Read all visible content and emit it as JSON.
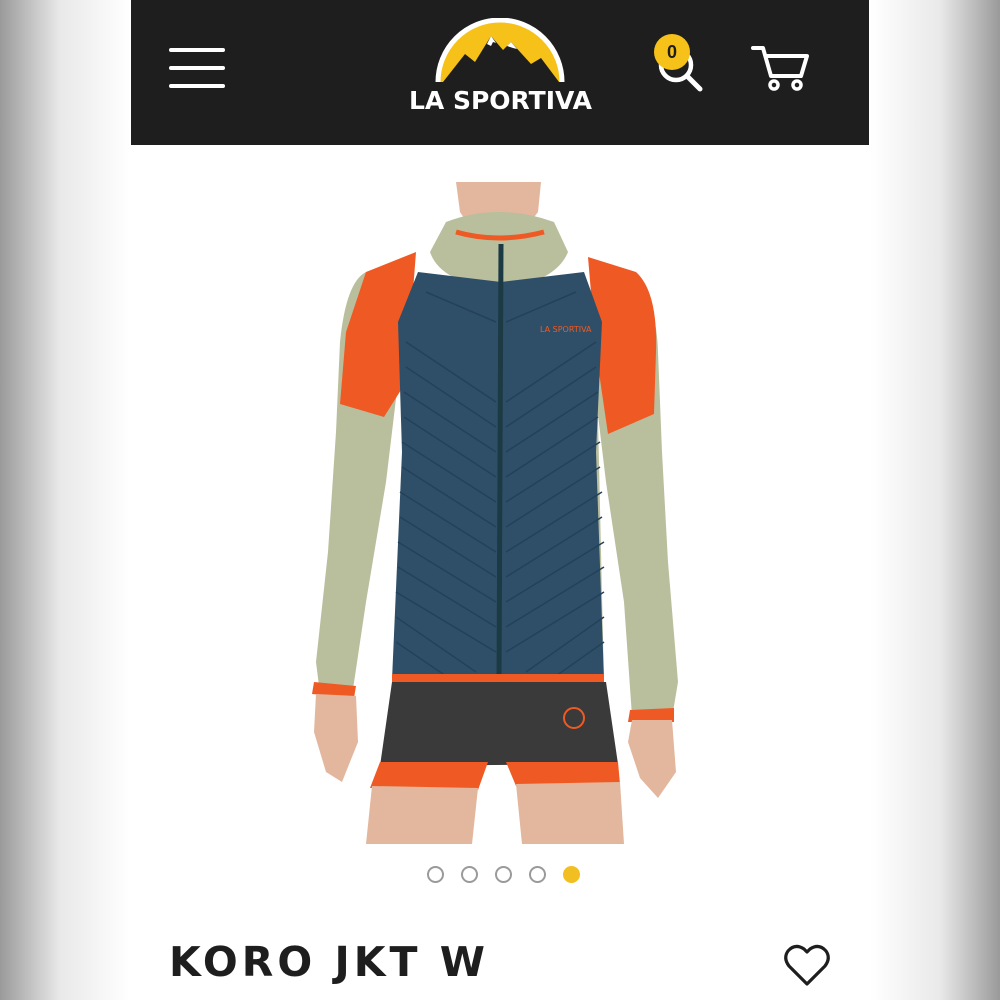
{
  "header": {
    "brand": "LA SPORTIVA",
    "cart_count": "0",
    "menu_icon": "hamburger-menu-icon",
    "search_icon": "search-icon",
    "cart_icon": "shopping-cart-icon"
  },
  "gallery": {
    "image_alt": "KORO JKT W",
    "slides": 5,
    "active_slide": 5
  },
  "product": {
    "title": "KORO JKT W",
    "wishlist_icon": "heart-icon"
  },
  "colors": {
    "header_bg": "#1e1e1e",
    "accent": "#f2bf22",
    "jacket_blue": "#2f4f68",
    "jacket_orange": "#ef5a24",
    "jacket_sage": "#b9bf9d"
  }
}
